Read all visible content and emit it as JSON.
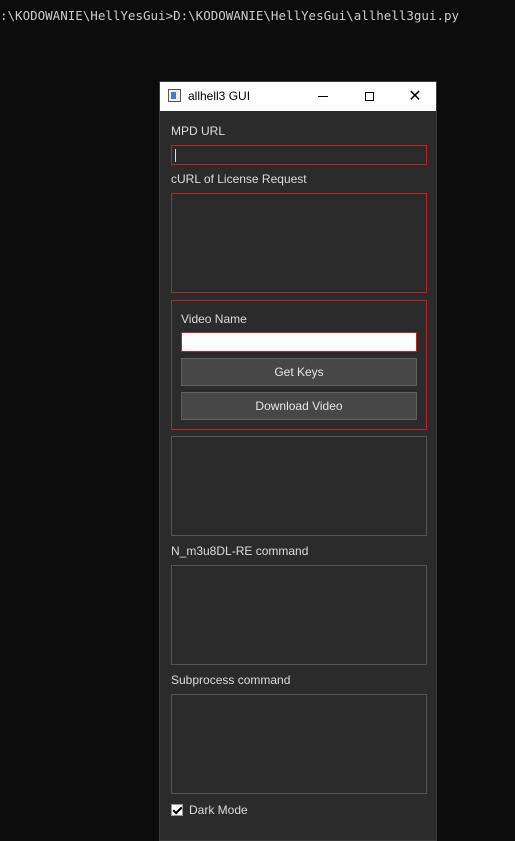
{
  "console": {
    "command_line": ":\\KODOWANIE\\HellYesGui>D:\\KODOWANIE\\HellYesGui\\allhell3gui.py"
  },
  "window": {
    "title": "allhell3 GUI",
    "icons": {
      "app": "app-window-icon",
      "minimize": "minimize-icon",
      "maximize": "maximize-icon",
      "close": "close-icon"
    }
  },
  "form": {
    "mpd_url_label": "MPD URL",
    "mpd_url_value": "",
    "curl_label": "cURL of License Request",
    "curl_value": "",
    "video_name_label": "Video Name",
    "video_name_value": "",
    "get_keys_label": "Get Keys",
    "download_video_label": "Download Video",
    "output_value": "",
    "n_m3u8dl_label": "N_m3u8DL-RE command",
    "n_m3u8dl_value": "",
    "subprocess_label": "Subprocess command",
    "subprocess_value": "",
    "dark_mode_label": "Dark Mode",
    "dark_mode_checked": true
  },
  "colors": {
    "console_bg": "#0c0c0c",
    "window_bg": "#2b2b2b",
    "accent_red": "#b3262b",
    "button_bg": "#474747"
  }
}
